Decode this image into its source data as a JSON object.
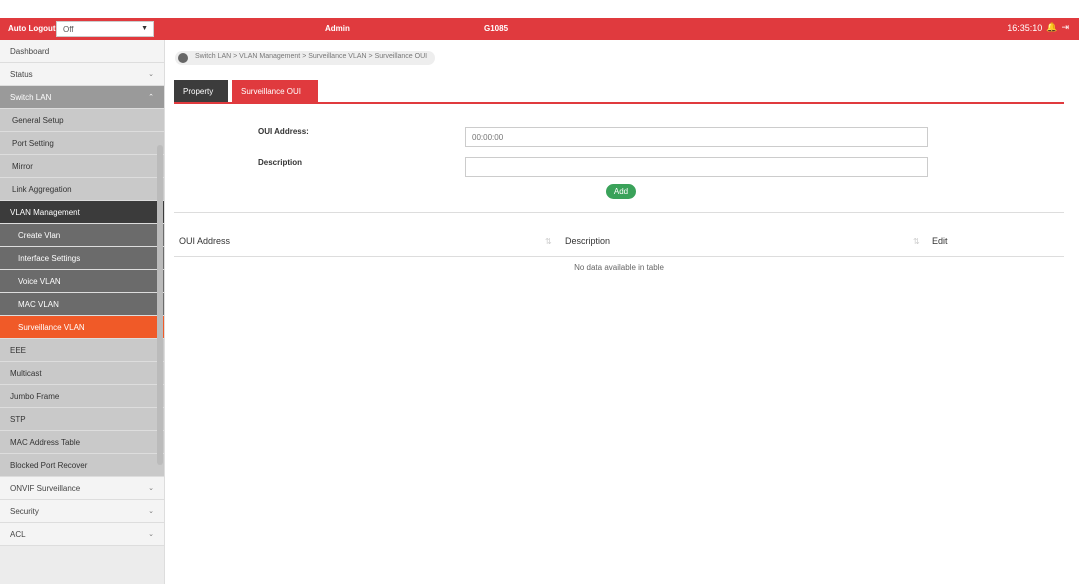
{
  "header": {
    "auto_logout_label": "Auto Logout :",
    "auto_logout_value": "Off",
    "user": "Admin",
    "model": "G1085",
    "time": "16:35:10"
  },
  "sidebar": {
    "items": [
      {
        "label": "Dashboard"
      },
      {
        "label": "Status"
      },
      {
        "label": "Switch LAN"
      },
      {
        "label": "General Setup"
      },
      {
        "label": "Port Setting"
      },
      {
        "label": "Mirror"
      },
      {
        "label": "Link Aggregation"
      },
      {
        "label": "VLAN Management"
      },
      {
        "label": "Create Vlan"
      },
      {
        "label": "Interface Settings"
      },
      {
        "label": "Voice VLAN"
      },
      {
        "label": "MAC VLAN"
      },
      {
        "label": "Surveillance VLAN"
      },
      {
        "label": "EEE"
      },
      {
        "label": "Multicast"
      },
      {
        "label": "Jumbo Frame"
      },
      {
        "label": "STP"
      },
      {
        "label": "MAC Address Table"
      },
      {
        "label": "Blocked Port Recover"
      },
      {
        "label": "ONVIF Surveillance"
      },
      {
        "label": "Security"
      },
      {
        "label": "ACL"
      }
    ]
  },
  "breadcrumb": "Switch LAN > VLAN Management > Surveillance VLAN > Surveillance OUI",
  "tabs": [
    {
      "label": "Property"
    },
    {
      "label": "Surveillance OUI"
    }
  ],
  "form": {
    "oui_label": "OUI Address:",
    "oui_placeholder": "00:00:00",
    "desc_label": "Description",
    "add_label": "Add"
  },
  "table": {
    "columns": [
      "OUI Address",
      "Description",
      "Edit"
    ],
    "empty_text": "No data available in table"
  }
}
